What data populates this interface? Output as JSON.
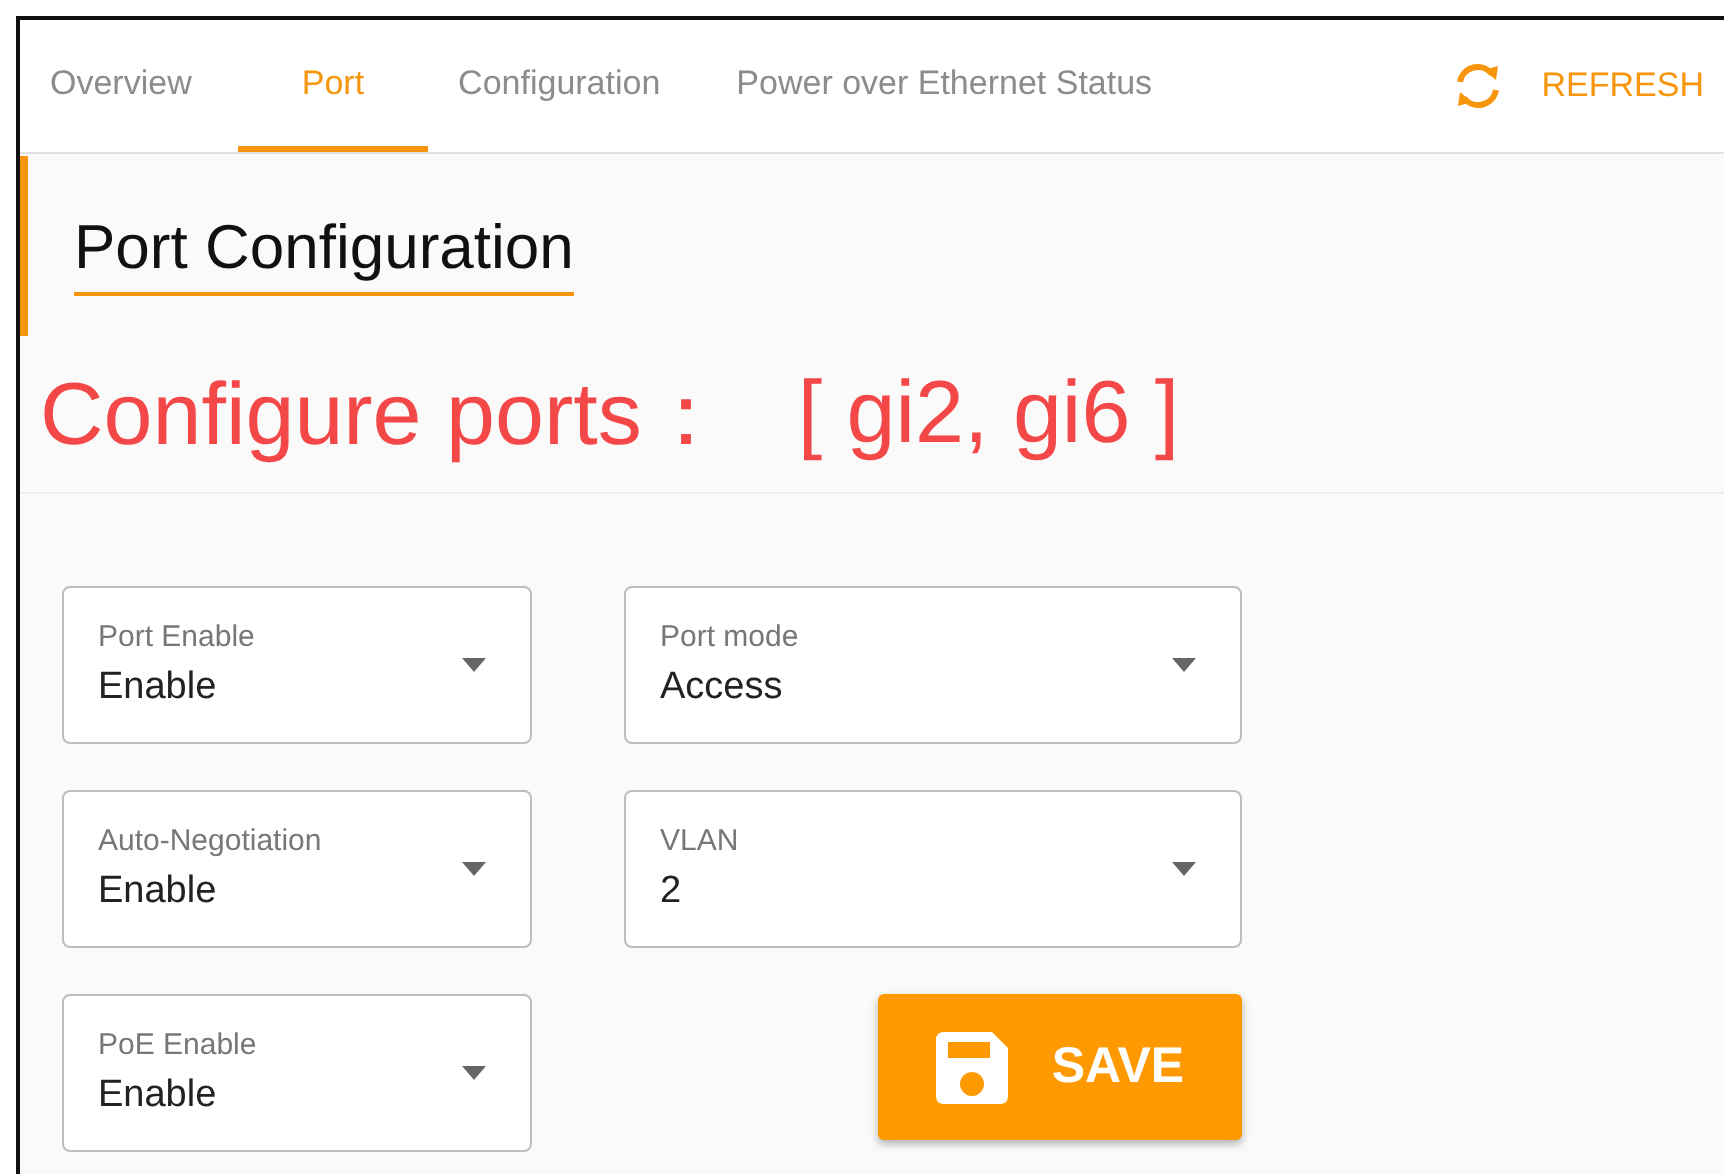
{
  "tabs": [
    {
      "label": "Overview",
      "selected": false
    },
    {
      "label": "Port",
      "selected": true
    },
    {
      "label": "Configuration",
      "selected": false
    },
    {
      "label": "Power over Ethernet Status",
      "selected": false
    }
  ],
  "refresh_button": {
    "label": "REFRESH"
  },
  "section_title": "Port Configuration",
  "configure_label": "Configure ports：",
  "configure_ports": "[ gi2, gi6 ]",
  "fields": [
    {
      "label": "Port Enable",
      "value": "Enable"
    },
    {
      "label": "Port mode",
      "value": "Access"
    },
    {
      "label": "Auto-Negotiation",
      "value": "Enable"
    },
    {
      "label": "VLAN",
      "value": "2"
    },
    {
      "label": "PoE Enable",
      "value": "Enable"
    }
  ],
  "save_button": {
    "label": "SAVE"
  }
}
